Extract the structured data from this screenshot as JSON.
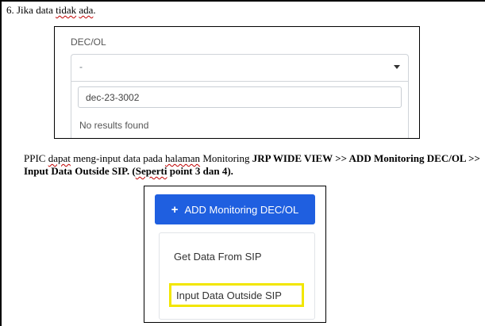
{
  "step": {
    "number": "6.",
    "text_before": "Jika data",
    "text_squiggle1": "tidak",
    "text_squiggle2": "ada",
    "text_after": "."
  },
  "shot1": {
    "field_label": "DEC/OL",
    "select_value": "-",
    "search_value": "dec-23-3002",
    "no_results": "No results found"
  },
  "paragraph": {
    "w1": "PPIC",
    "w2": "dapat",
    "w3": "meng-input data pada",
    "w4": "halaman",
    "w5": "Monitoring",
    "bold1": "JRP WIDE VIEW >> ADD Monitoring DEC/OL >> Input Data Outside SIP. (",
    "bold_squiggle": "Seperti",
    "bold2": "point 3 dan 4)."
  },
  "shot2": {
    "add_button_label": "ADD Monitoring DEC/OL",
    "menu_item_1": "Get Data From SIP",
    "menu_item_2": "Input Data Outside SIP",
    "highlight_color": "#f2e600",
    "button_color": "#1f5fe0"
  }
}
